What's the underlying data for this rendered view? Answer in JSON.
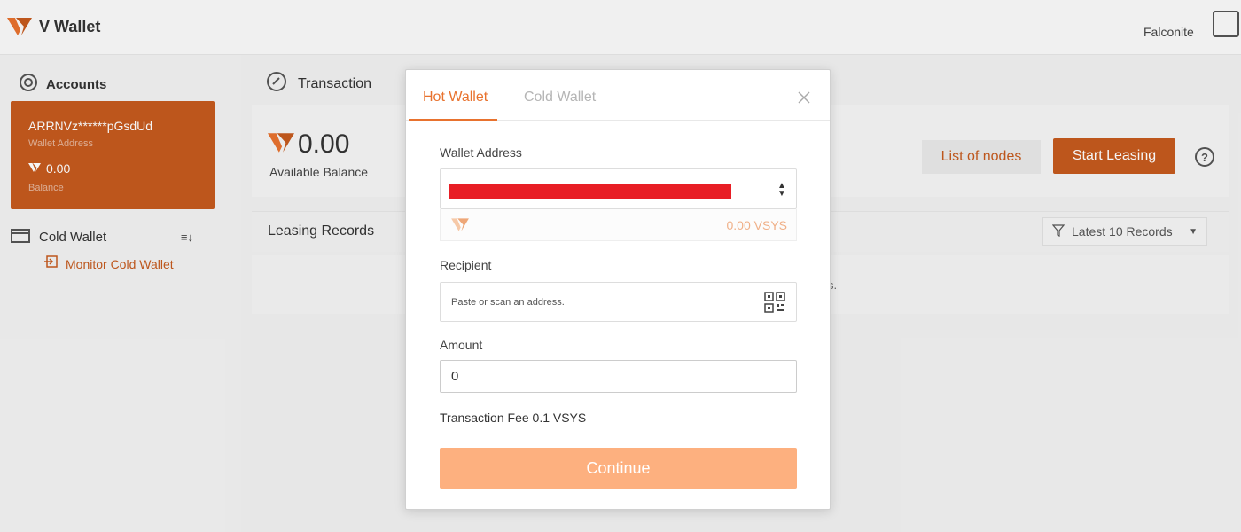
{
  "app": {
    "title": "V Wallet",
    "user": "Falconite"
  },
  "sidebar": {
    "accounts_label": "Accounts",
    "account": {
      "address": "ARRNVz******pGsdUd",
      "address_caption": "Wallet Address",
      "balance": "0.00",
      "balance_caption": "Balance"
    },
    "cold_wallet_label": "Cold Wallet",
    "monitor_label": "Monitor Cold Wallet"
  },
  "main": {
    "section_title": "Transaction",
    "balance_value": "0.00",
    "balance_caption": "Available Balance",
    "list_nodes_label": "List of nodes",
    "start_leasing_label": "Start Leasing",
    "help_symbol": "?",
    "records_title": "Leasing Records",
    "records_filter": "Latest 10 Records",
    "records_empty": "s."
  },
  "modal": {
    "tabs": [
      {
        "label": "Hot Wallet",
        "active": true
      },
      {
        "label": "Cold Wallet",
        "active": false
      }
    ],
    "wallet_address_label": "Wallet Address",
    "wallet_balance": "0.00 VSYS",
    "recipient_label": "Recipient",
    "recipient_placeholder": "Paste or scan an address.",
    "amount_label": "Amount",
    "amount_value": "0",
    "fee_text": "Transaction Fee 0.1 VSYS",
    "continue_label": "Continue"
  },
  "colors": {
    "brand": "#c55a1e",
    "accent": "#e8722e",
    "button_disabled": "#fdb07f",
    "redaction": "#e81e25"
  },
  "icons": {
    "logo": "v-logo-icon",
    "accounts": "accounts-icon",
    "transaction": "transaction-icon",
    "cold_wallet": "cold-wallet-icon",
    "monitor": "monitor-icon",
    "close": "close-icon",
    "qr": "qr-code-icon",
    "filter": "filter-icon"
  }
}
